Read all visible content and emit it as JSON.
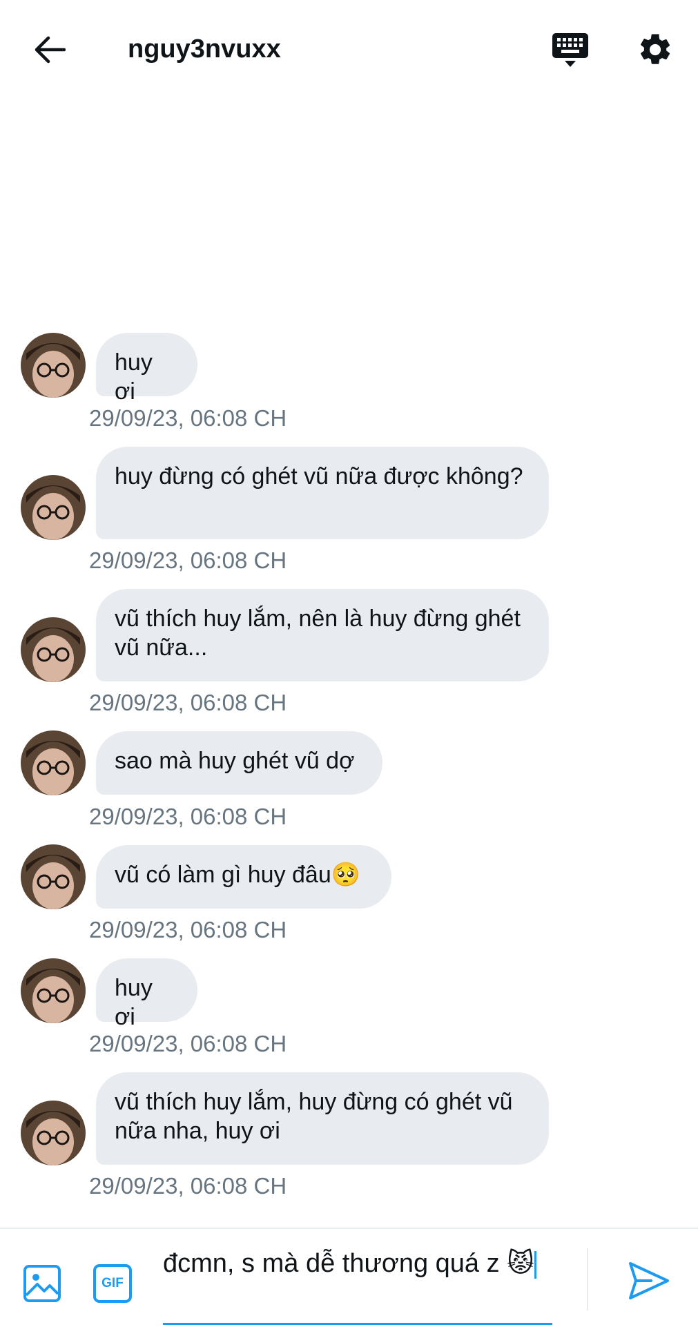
{
  "header": {
    "title": "nguy3nvuxx",
    "back_icon": "arrow-left-icon",
    "keyboard_icon": "keyboard-icon",
    "settings_icon": "gear-icon"
  },
  "messages": [
    {
      "text": "huy ơi",
      "timestamp": "29/09/23, 06:08 CH"
    },
    {
      "text": "huy đừng có ghét vũ nữa được không?",
      "timestamp": "29/09/23, 06:08 CH"
    },
    {
      "text": "vũ thích huy lắm, nên là huy đừng ghét vũ nữa...",
      "timestamp": "29/09/23, 06:08 CH"
    },
    {
      "text": "sao mà huy ghét vũ dợ",
      "timestamp": "29/09/23, 06:08 CH"
    },
    {
      "text": "vũ có làm gì huy đâu🥺",
      "timestamp": "29/09/23, 06:08 CH"
    },
    {
      "text": "huy ơi",
      "timestamp": "29/09/23, 06:08 CH"
    },
    {
      "text": "vũ thích huy lắm, huy đừng có ghét vũ nữa nha, huy ơi",
      "timestamp": "29/09/23, 06:08 CH"
    }
  ],
  "composer": {
    "value": "đcmn, s mà dễ thương quá z 😾",
    "image_icon": "image-icon",
    "gif_label": "GIF",
    "send_icon": "send-icon"
  },
  "colors": {
    "accent": "#1d9bf0",
    "bubble": "#e8ecf0",
    "timestamp": "#66757f"
  }
}
